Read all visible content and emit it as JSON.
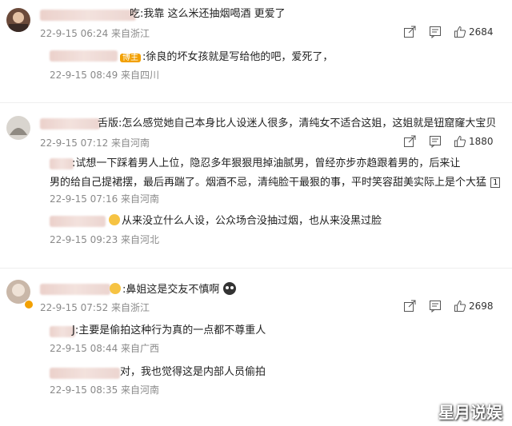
{
  "comments": [
    {
      "text": "吃:我靠 这么米还抽烟喝酒 更爱了",
      "meta": "22-9-15 06:24 来自浙江",
      "likes": "2684",
      "replies": [
        {
          "badge": "博主",
          "text": ":徐良的坏女孩就是写给他的吧，爱死了，",
          "meta": "22-9-15 08:49 来自四川"
        }
      ]
    },
    {
      "text": "舌版:怎么感觉她自己本身比人设迷人很多，清纯女不适合这姐，这姐就是钮窟窿大宝贝",
      "meta": "22-9-15 07:12 来自河南",
      "likes": "1880",
      "replies": [
        {
          "line1": ":试想一下踩着男人上位，隐忍多年狠狠甩掉油腻男，曾经亦步亦趋跟着男的，后来让",
          "line2": "男的给自己提裙摆，最后再踹了。烟酒不忌，清纯脸干最狠的事，平时笑容甜美实际上是个大猛",
          "more": "1",
          "meta": "22-9-15 07:16 来自河南"
        },
        {
          "text": "从来没立什么人设，公众场合没抽过烟，也从来没黑过脸",
          "meta": "22-9-15 09:23 来自河北"
        }
      ]
    },
    {
      "text": ":鼻姐这是交友不慎啊",
      "meta": "22-9-15 07:52 来自浙江",
      "likes": "2698",
      "replies": [
        {
          "text": "J:主要是偷拍这种行为真的一点都不尊重人",
          "meta": "22-9-15 08:44 来自广西"
        },
        {
          "text": "对，我也觉得这是内部人员偷拍",
          "meta": "22-9-15 08:35 来自河南"
        }
      ]
    }
  ],
  "watermark": "星月说娱",
  "colors": {
    "accent": "#f2a000",
    "meta": "#8a8a8a",
    "name_blur": "#e8c9c2"
  }
}
